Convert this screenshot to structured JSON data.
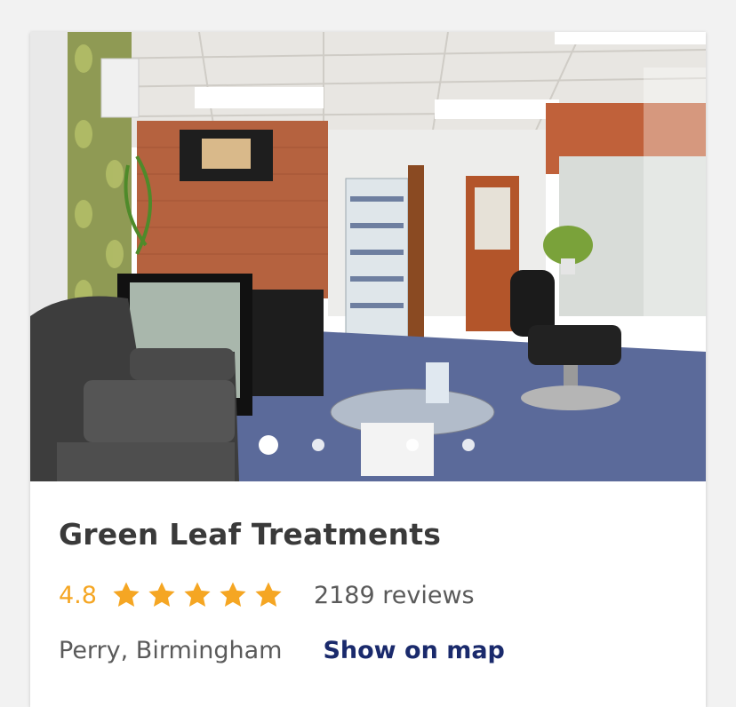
{
  "listing": {
    "name": "Green Leaf Treatments",
    "rating": "4.8",
    "star_count": 5,
    "reviews": "2189 reviews",
    "location": "Perry, Birmingham",
    "map_link": "Show on map"
  },
  "gallery": {
    "image": "salon interior photo",
    "current_index": 1,
    "total": 4
  },
  "colors": {
    "rating": "#f5a623",
    "star": "#f5a623",
    "title": "#3a3a3a",
    "secondary_text": "#5a5a5a",
    "link": "#1a2a6c"
  },
  "icons": {
    "rating_star": "star-icon"
  }
}
